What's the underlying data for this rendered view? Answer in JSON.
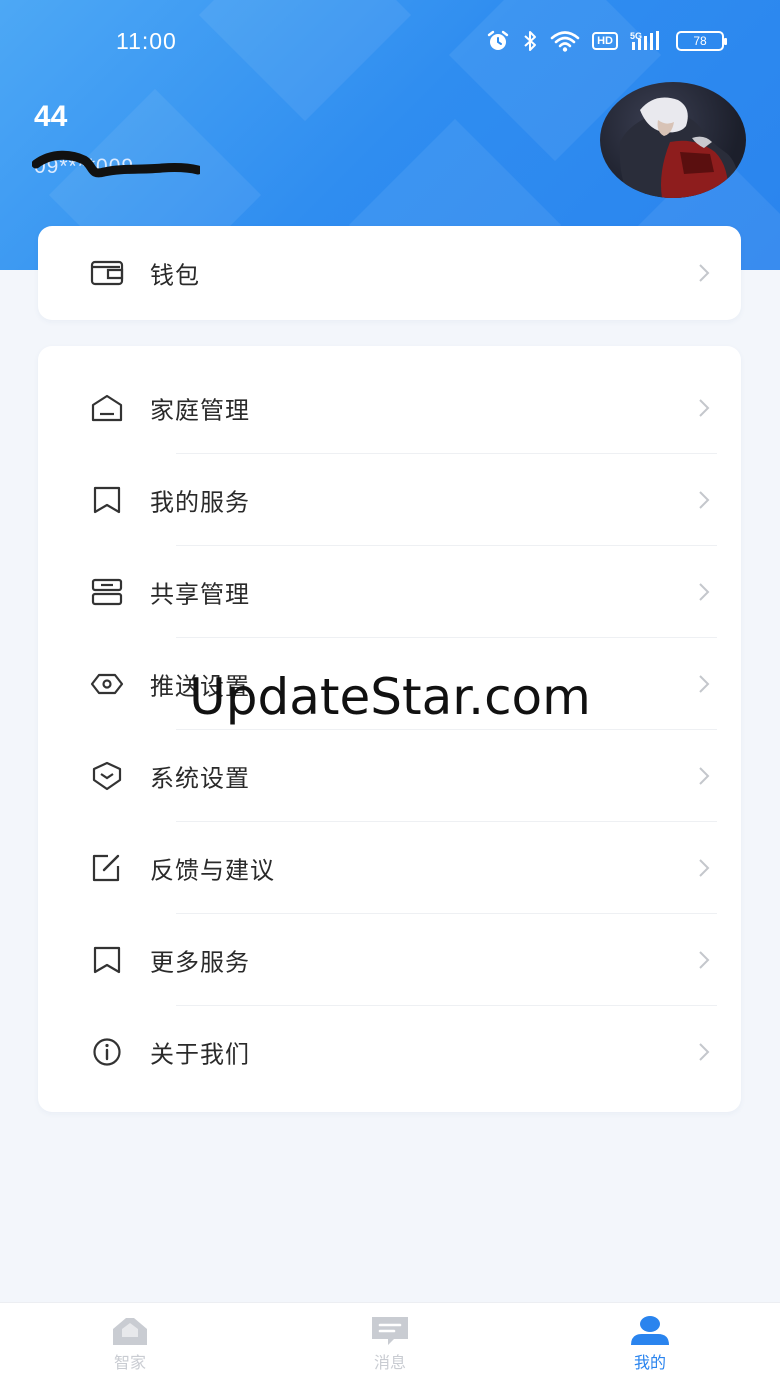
{
  "status_bar": {
    "time": "11:00",
    "hd_label": "HD",
    "network_label": "5G",
    "battery": "78",
    "icons": [
      "alarm-icon",
      "bluetooth-icon",
      "wifi-icon",
      "hd-icon",
      "signal-icon",
      "battery-icon"
    ]
  },
  "profile": {
    "name": "44",
    "phone": "09****009"
  },
  "wallet_card": {
    "items": [
      {
        "label": "钱包",
        "icon": "wallet-icon"
      }
    ]
  },
  "menu_card": {
    "items": [
      {
        "label": "家庭管理",
        "icon": "home-icon"
      },
      {
        "label": "我的服务",
        "icon": "bookmark-icon"
      },
      {
        "label": "共享管理",
        "icon": "share-manage-icon"
      },
      {
        "label": "推送设置",
        "icon": "push-eye-icon"
      },
      {
        "label": "系统设置",
        "icon": "shield-settings-icon"
      },
      {
        "label": "反馈与建议",
        "icon": "edit-feedback-icon"
      },
      {
        "label": "更多服务",
        "icon": "bookmark-icon"
      },
      {
        "label": "关于我们",
        "icon": "info-icon"
      }
    ]
  },
  "watermark": "UpdateStar.com",
  "tabbar": {
    "tabs": [
      {
        "label": "智家",
        "icon": "house-icon",
        "active": false
      },
      {
        "label": "消息",
        "icon": "message-icon",
        "active": false
      },
      {
        "label": "我的",
        "icon": "user-icon",
        "active": true
      }
    ]
  },
  "colors": {
    "header_blue": "#2f8df0",
    "active_tab": "#2a84ee",
    "inactive_tab": "#c9ccd2",
    "background": "#f3f6fb"
  }
}
